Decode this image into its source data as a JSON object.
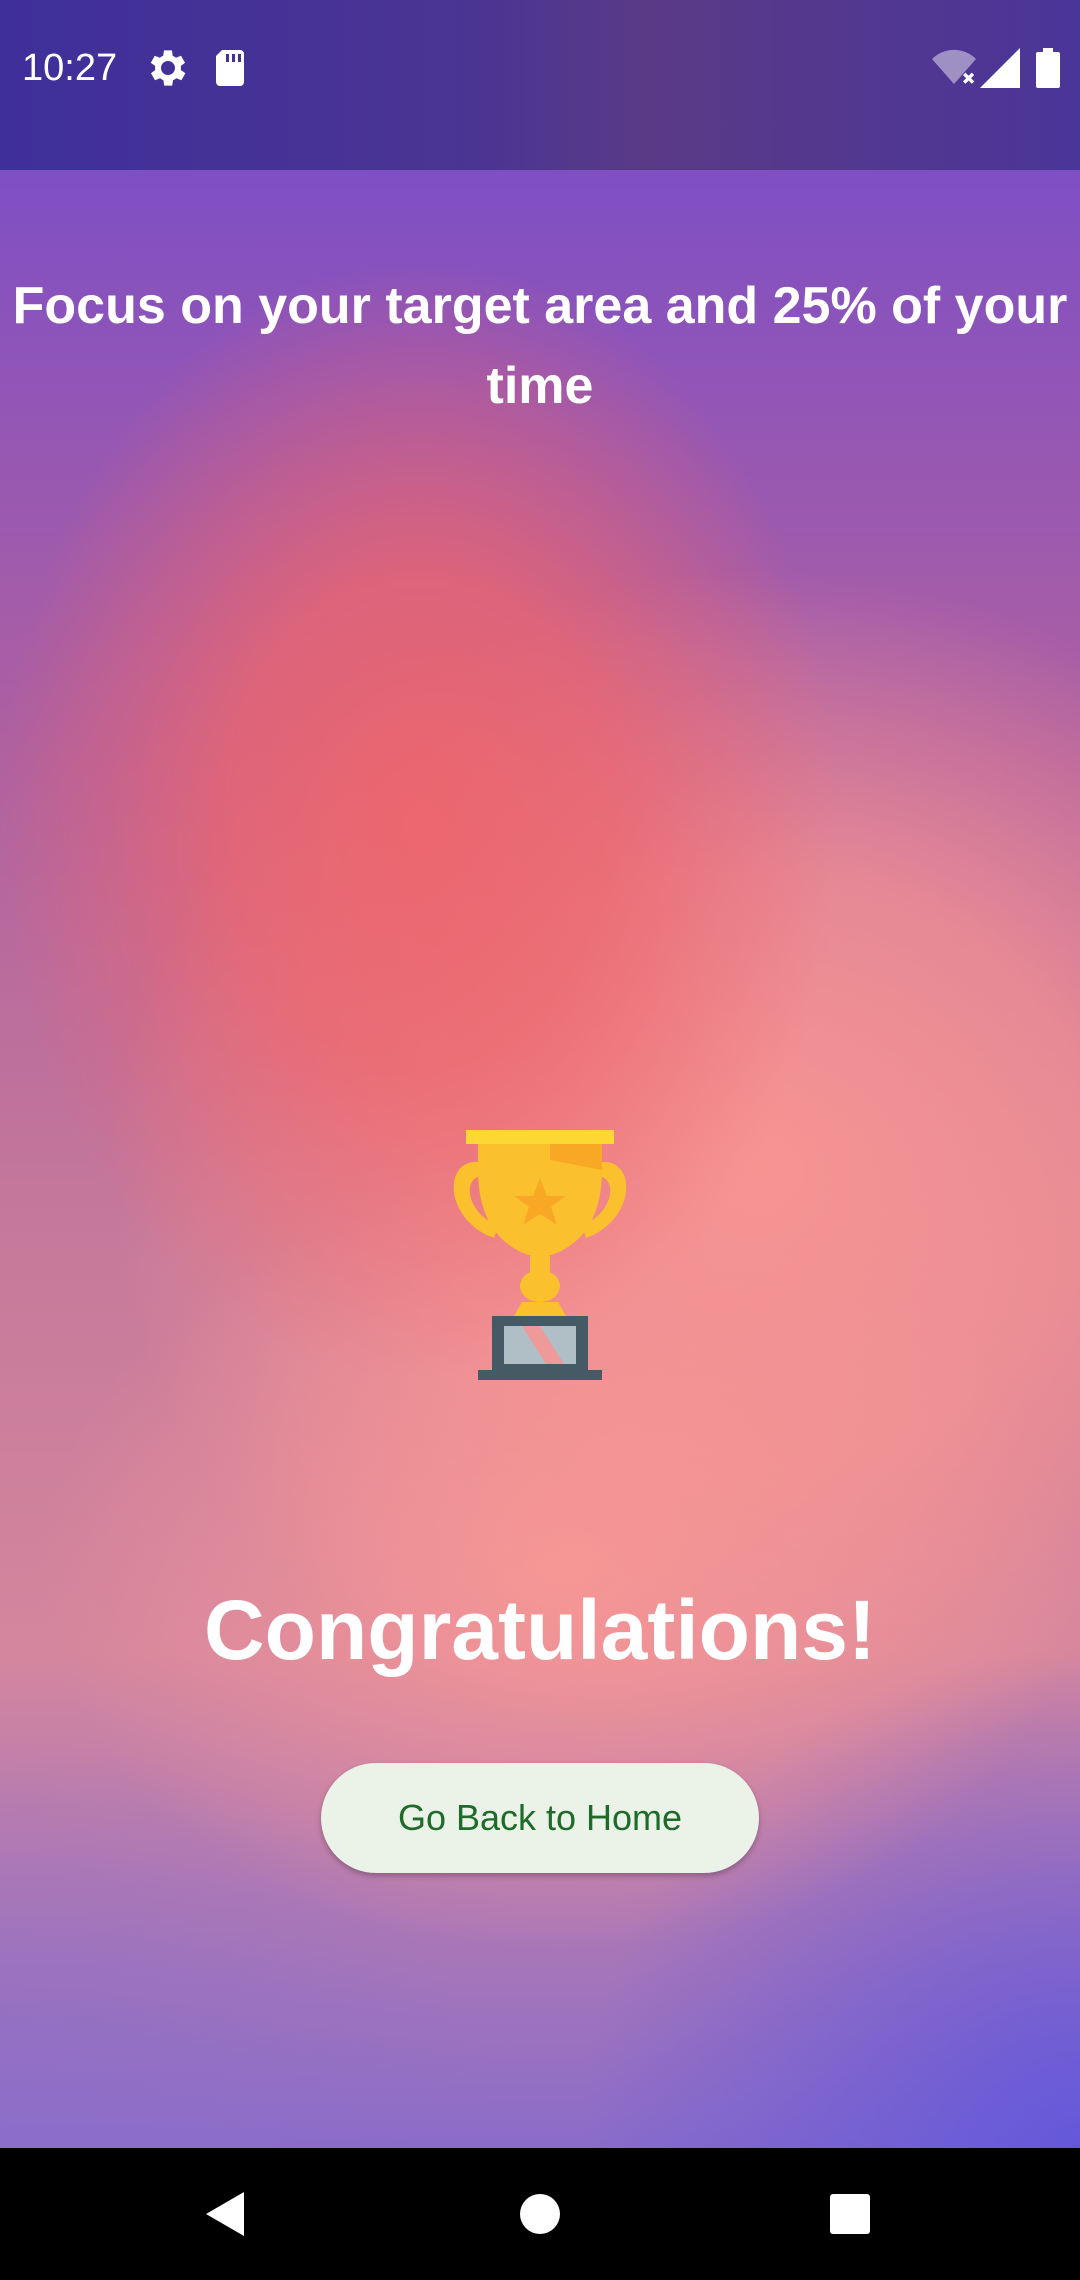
{
  "status_bar": {
    "time": "10:27",
    "icons": [
      "gear-icon",
      "sd-card-icon",
      "wifi-off-icon",
      "cell-signal-icon",
      "battery-icon"
    ]
  },
  "main": {
    "headline": "Focus on your target area and 25% of your time",
    "trophy_icon": "trophy-icon",
    "congrats_text": "Congratulations!",
    "home_button_label": "Go Back to Home"
  },
  "nav_bar": {
    "icons": [
      "back-icon",
      "home-icon",
      "recents-icon"
    ]
  },
  "colors": {
    "button_bg": "#ebf2e7",
    "button_text": "#1f6b2b",
    "trophy_gold": "#fbc02d",
    "trophy_base": "#455a64"
  }
}
